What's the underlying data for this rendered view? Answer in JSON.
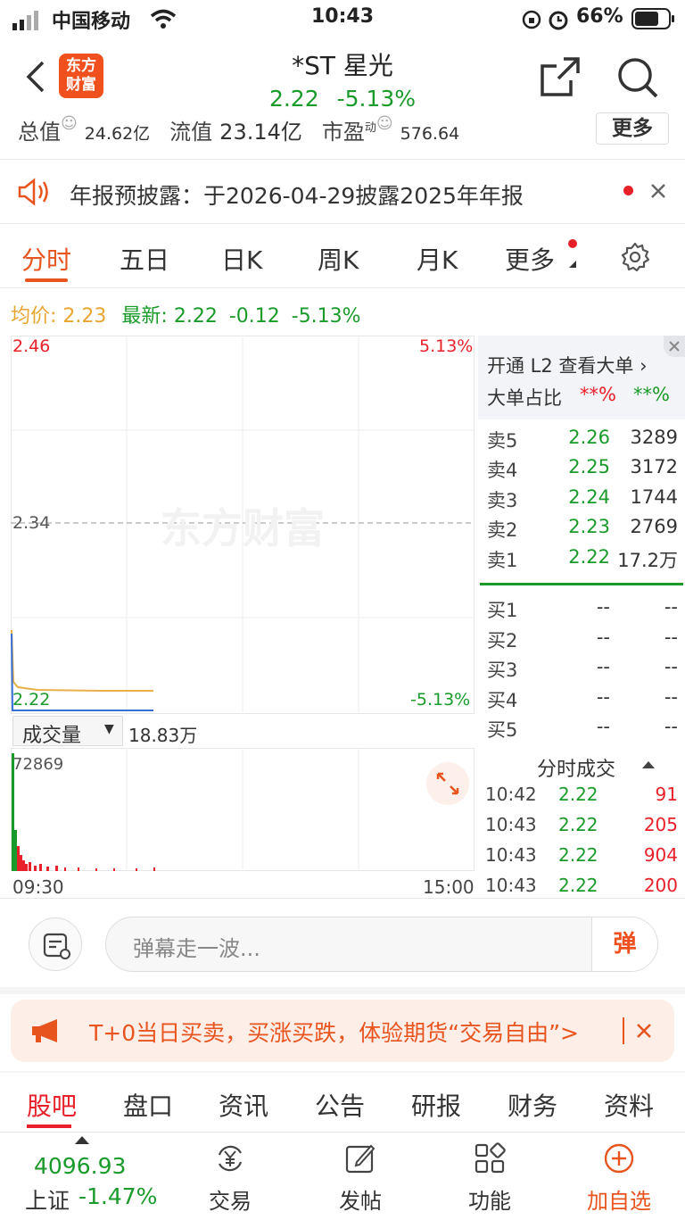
{
  "status_bar": {
    "carrier": "中国移动",
    "time": "10:43",
    "battery": "66%"
  },
  "header": {
    "logo_text": [
      "东方",
      "财富"
    ],
    "stock_name": "*ST 星光",
    "price": "2.22",
    "change_pct": "-5.13%"
  },
  "metrics": {
    "total_value_label": "总值",
    "total_value": "24.62亿",
    "float_value_label": "流值",
    "float_value": "23.14亿",
    "pe_label": "市盈",
    "pe_sup": "动",
    "pe_value": "576.64",
    "more_label": "更多"
  },
  "notice": {
    "text": "年报预披露：于2026-04-29披露2025年年报"
  },
  "chart_tabs": [
    "分时",
    "五日",
    "日K",
    "周K",
    "月K",
    "更多"
  ],
  "avg_line": {
    "avg_label": "均价:",
    "avg_value": "2.23",
    "latest_label": "最新:",
    "latest_value": "2.22",
    "change": "-0.12",
    "change_pct": "-5.13%"
  },
  "chart": {
    "high": "2.46",
    "high_pct": "5.13%",
    "mid": "2.34",
    "low": "2.22",
    "low_pct": "-5.13%",
    "watermark": "东方财富",
    "volume_label": "成交量",
    "volume_total": "18.83万",
    "volume_max": "72869",
    "time_start": "09:30",
    "time_end": "15:00",
    "colors": {
      "up": "#e8202a",
      "down": "#1a9a2a",
      "price_line": "#3a6fd8",
      "avg_line": "#e8b04a"
    }
  },
  "l2_panel": {
    "title": "开通 L2 查看大单 ›",
    "ratio_label": "大单占比",
    "ratio_red": "**%",
    "ratio_green": "**%"
  },
  "order_book": {
    "sells": [
      {
        "label": "卖5",
        "price": "2.26",
        "qty": "3289"
      },
      {
        "label": "卖4",
        "price": "2.25",
        "qty": "3172"
      },
      {
        "label": "卖3",
        "price": "2.24",
        "qty": "1744"
      },
      {
        "label": "卖2",
        "price": "2.23",
        "qty": "2769"
      },
      {
        "label": "卖1",
        "price": "2.22",
        "qty": "17.2万"
      }
    ],
    "buys": [
      {
        "label": "买1",
        "price": "--",
        "qty": "--"
      },
      {
        "label": "买2",
        "price": "--",
        "qty": "--"
      },
      {
        "label": "买3",
        "price": "--",
        "qty": "--"
      },
      {
        "label": "买4",
        "price": "--",
        "qty": "--"
      },
      {
        "label": "买5",
        "price": "--",
        "qty": "--"
      }
    ]
  },
  "ticks": {
    "title": "分时成交",
    "rows": [
      {
        "time": "10:42",
        "price": "2.22",
        "qty": "91"
      },
      {
        "time": "10:43",
        "price": "2.22",
        "qty": "205"
      },
      {
        "time": "10:43",
        "price": "2.22",
        "qty": "904"
      },
      {
        "time": "10:43",
        "price": "2.22",
        "qty": "200"
      }
    ]
  },
  "danmu": {
    "placeholder": "弹幕走一波...",
    "button": "弹"
  },
  "promo": {
    "text": "T+0当日买卖，买涨买跌，体验期货“交易自由”>"
  },
  "bottom_tabs": [
    "股吧",
    "盘口",
    "资讯",
    "公告",
    "研报",
    "财务",
    "资料"
  ],
  "index": {
    "value": "4096.93",
    "name": "上证",
    "change": "-1.47%"
  },
  "bottom_nav": [
    "交易",
    "发帖",
    "功能",
    "加自选"
  ]
}
